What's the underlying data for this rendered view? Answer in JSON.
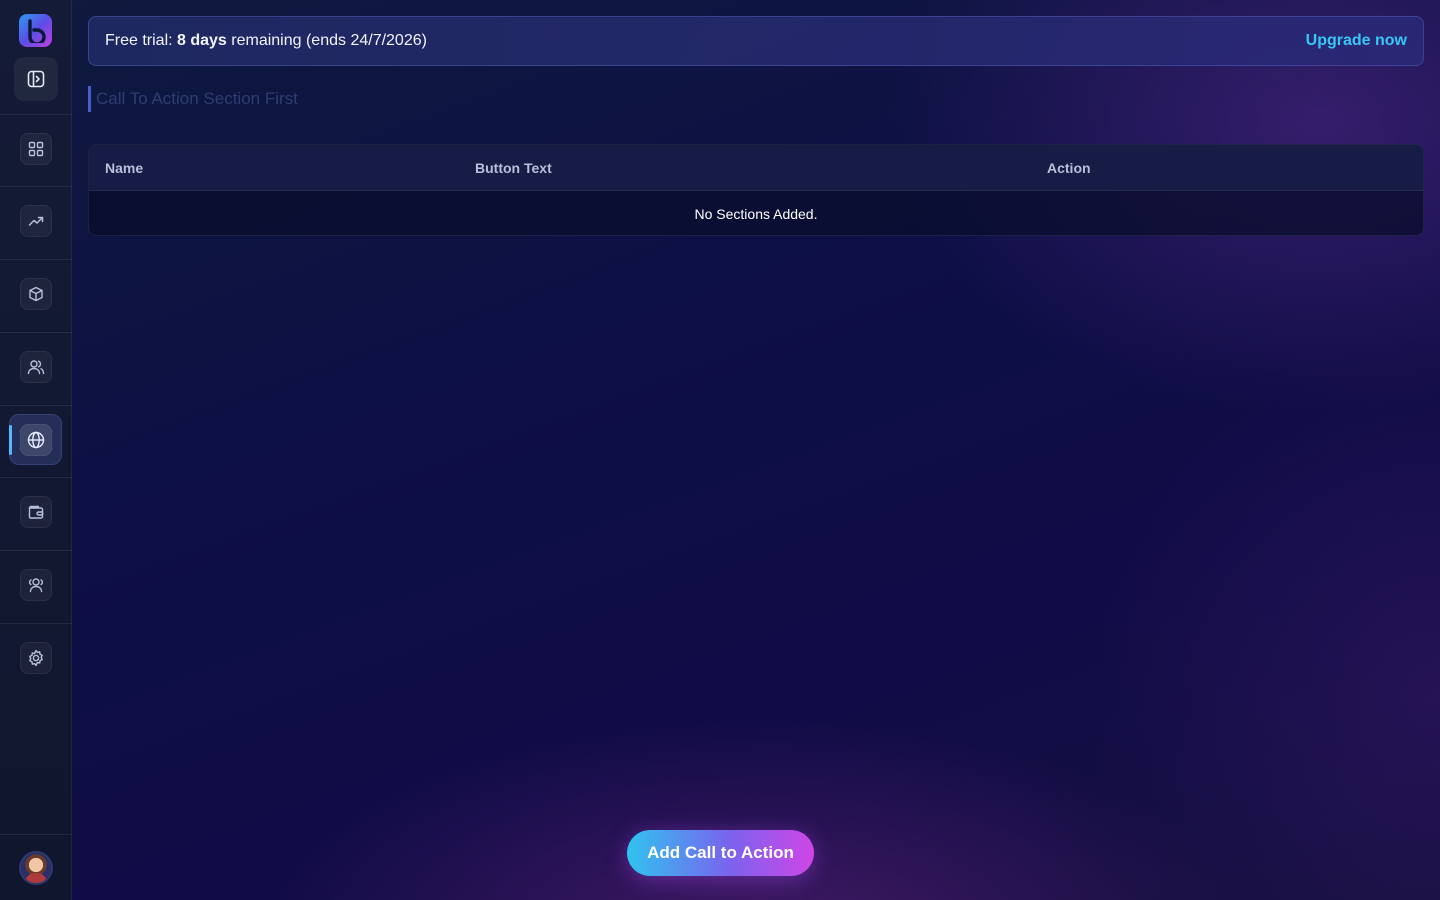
{
  "sidebar": {
    "logo_icon": "logo-b-icon",
    "toggle_icon": "sidebar-toggle-icon",
    "items": [
      {
        "icon": "dashboard-grid-icon",
        "active": false
      },
      {
        "icon": "trending-up-icon",
        "active": false
      },
      {
        "icon": "box-icon",
        "active": false
      },
      {
        "icon": "users-icon",
        "active": false
      },
      {
        "icon": "globe-icon",
        "active": true
      },
      {
        "icon": "wallet-icon",
        "active": false
      },
      {
        "icon": "team-icon",
        "active": false
      },
      {
        "icon": "settings-icon",
        "active": false
      }
    ],
    "avatar_icon": "user-avatar"
  },
  "trial_banner": {
    "prefix": "Free trial: ",
    "days": "8 days",
    "suffix": " remaining (ends 24/7/2026)",
    "upgrade_label": "Upgrade now"
  },
  "section": {
    "title": "Call To Action Section First"
  },
  "table": {
    "columns": [
      "Name",
      "Button Text",
      "Action"
    ],
    "empty_message": "No Sections Added."
  },
  "add_button": {
    "label": "Add Call to Action"
  },
  "colors": {
    "accent_cyan": "#38c7f5",
    "gradient_start": "#2fc3f0",
    "gradient_end": "#d046e6",
    "active_indicator": "#4fb8ff"
  }
}
